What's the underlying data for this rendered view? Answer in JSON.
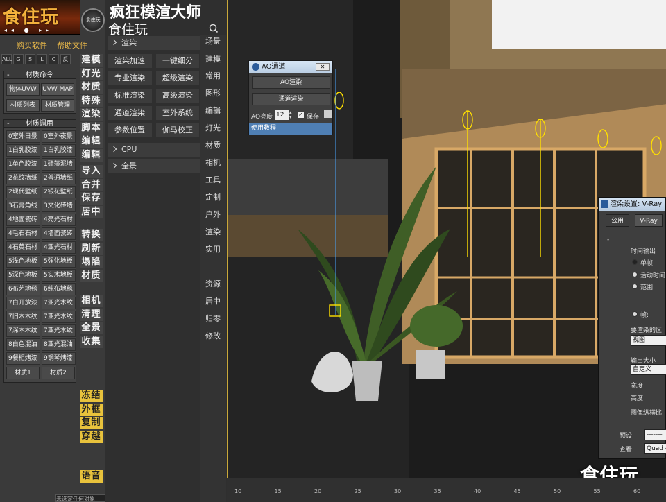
{
  "brand": {
    "logo_text": "食住玩",
    "badge_text": "食住玩",
    "player_glyphs": "◂◂ ● ▸▸"
  },
  "links": {
    "buy": "购买软件",
    "help": "帮助文件"
  },
  "filters": [
    "ALL",
    "G",
    "S",
    "L",
    "C",
    "反"
  ],
  "material_commands": {
    "header": "材质命令",
    "buttons": [
      "物体UVW",
      "UVW MAP",
      "材质列表",
      "材质管理"
    ]
  },
  "material_call": {
    "header": "材质调用",
    "items": [
      "0室外日景",
      "0室外夜景",
      "1白乳胶漆",
      "1白乳胶漆",
      "1单色胶漆",
      "1硅藻泥墙",
      "2花纹墙纸",
      "2普通墙纸",
      "2现代壁纸",
      "2银花壁纸",
      "3石膏角线",
      "3文化砖墙",
      "4地面瓷砖",
      "4亮光石材",
      "4毛石石材",
      "4墙面瓷砖",
      "4石英石材",
      "4亚光石材",
      "5浅色地板",
      "5强化地板",
      "5深色地板",
      "5实木地板",
      "6布艺地毯",
      "6纯布地毯",
      "7白开放漆",
      "7亚光木纹",
      "7旧木木纹",
      "7亚光木纹",
      "7深木木纹",
      "7亚光木纹",
      "8白色混油",
      "8亚光混油",
      "9餐柜烤漆",
      "9钢琴烤漆"
    ],
    "tabs": [
      "材质1",
      "材质2"
    ]
  },
  "side_tools": {
    "group1": [
      "建模",
      "灯光",
      "材质",
      "特殊",
      "渲染",
      "脚本",
      "编辑",
      "编辑"
    ],
    "group2": [
      "导入",
      "合并",
      "保存",
      "居中"
    ],
    "group3": [
      "转换",
      "刷新",
      "塌陷",
      "材质"
    ],
    "group4": [
      "相机",
      "清理",
      "全景",
      "收集"
    ],
    "group5": [
      "冻结",
      "外框",
      "复制",
      "穿越"
    ],
    "voice": "语音"
  },
  "app": {
    "title": "疯狂模渲大师",
    "subtitle": "食住玩"
  },
  "render_section": {
    "header": "渲染",
    "buttons": [
      "渲染加速",
      "一键细分",
      "专业渲染",
      "超级渲染",
      "标准渲染",
      "高级渲染",
      "通道渲染",
      "室外系统",
      "参数位置",
      "伽马校正"
    ]
  },
  "sections": [
    "CPU",
    "全景"
  ],
  "right_nav": [
    "场景",
    "建模",
    "常用",
    "图形",
    "编辑",
    "灯光",
    "材质",
    "相机",
    "工具",
    "定制",
    "户外",
    "渲染",
    "实用",
    "资源",
    "居中",
    "归零",
    "修改"
  ],
  "ao_dialog": {
    "title": "AO通道",
    "close": "✕",
    "btn1": "AO渲染",
    "btn2": "通道渲染",
    "label": "AO亮度",
    "value": "12",
    "save": "保存",
    "tutorial": "使用教程"
  },
  "render_settings": {
    "title": "渲染设置: V-Ray",
    "tabs": [
      "公用",
      "V-Ray"
    ],
    "time_output": "时间输出",
    "radios": [
      "单帧",
      "活动时间",
      "范围:",
      "帧:"
    ],
    "area": "要渲染的区",
    "area_value": "视图",
    "size": "输出大小",
    "size_value": "自定义",
    "width": "宽度:",
    "height": "高度:",
    "aspect": "图像纵横比",
    "preset": "预设:",
    "preset_value": "-------",
    "view": "查看:",
    "view_value": "Quad 4"
  },
  "ruler": [
    "10",
    "15",
    "20",
    "25",
    "30",
    "35",
    "40",
    "45",
    "50",
    "55",
    "60"
  ],
  "watermark": "食住玩",
  "status": "未选定任何对象"
}
